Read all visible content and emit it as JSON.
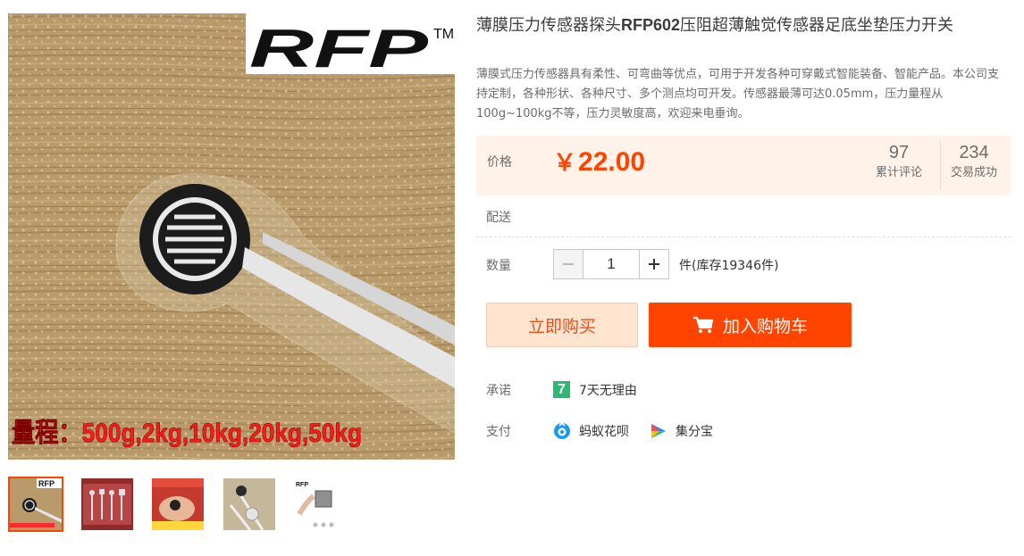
{
  "product": {
    "title_prefix": "薄膜压力传感器探头",
    "title_model": "RFP602",
    "title_suffix": "压阻超薄触觉传感器足底坐垫压力开关",
    "subtitle": "薄膜式压力传感器具有柔性、可弯曲等优点，可用于开发各种可穿戴式智能装备、智能产品。本公司支持定制，各种形状、各种尺寸、多个测点均可开发。传感器最薄可达0.05mm，压力量程从100g~100kg不等，压力灵敏度高，欢迎来电垂询。"
  },
  "gallery": {
    "brand_logo": "RFP",
    "trademark": "TM",
    "range_caption": "量程：500g,2kg,10kg,20kg,50kg",
    "thumbnails": [
      {
        "name": "thumb-1",
        "active": true
      },
      {
        "name": "thumb-2",
        "active": false
      },
      {
        "name": "thumb-3",
        "active": false
      },
      {
        "name": "thumb-4",
        "active": false
      },
      {
        "name": "thumb-5",
        "active": false
      }
    ],
    "thumb_small_logo": "RFP"
  },
  "price": {
    "label": "价格",
    "currency": "￥",
    "amount": "22.00",
    "reviews_count": "97",
    "reviews_label": "累计评论",
    "deals_count": "234",
    "deals_label": "交易成功"
  },
  "shipping": {
    "label": "配送"
  },
  "quantity": {
    "label": "数量",
    "value": "1",
    "stock_text": "件(库存19346件)"
  },
  "actions": {
    "buy_now": "立即购买",
    "add_to_cart": "加入购物车"
  },
  "promise": {
    "label": "承诺",
    "badge": "7",
    "text": "7天无理由"
  },
  "payment": {
    "label": "支付",
    "methods": [
      "蚂蚁花呗",
      "集分宝"
    ]
  },
  "colors": {
    "accent": "#ff4400",
    "price_bg": "#fff2e8",
    "buy_now_bg": "#ffe4d0",
    "promise_green": "#2eb872"
  }
}
